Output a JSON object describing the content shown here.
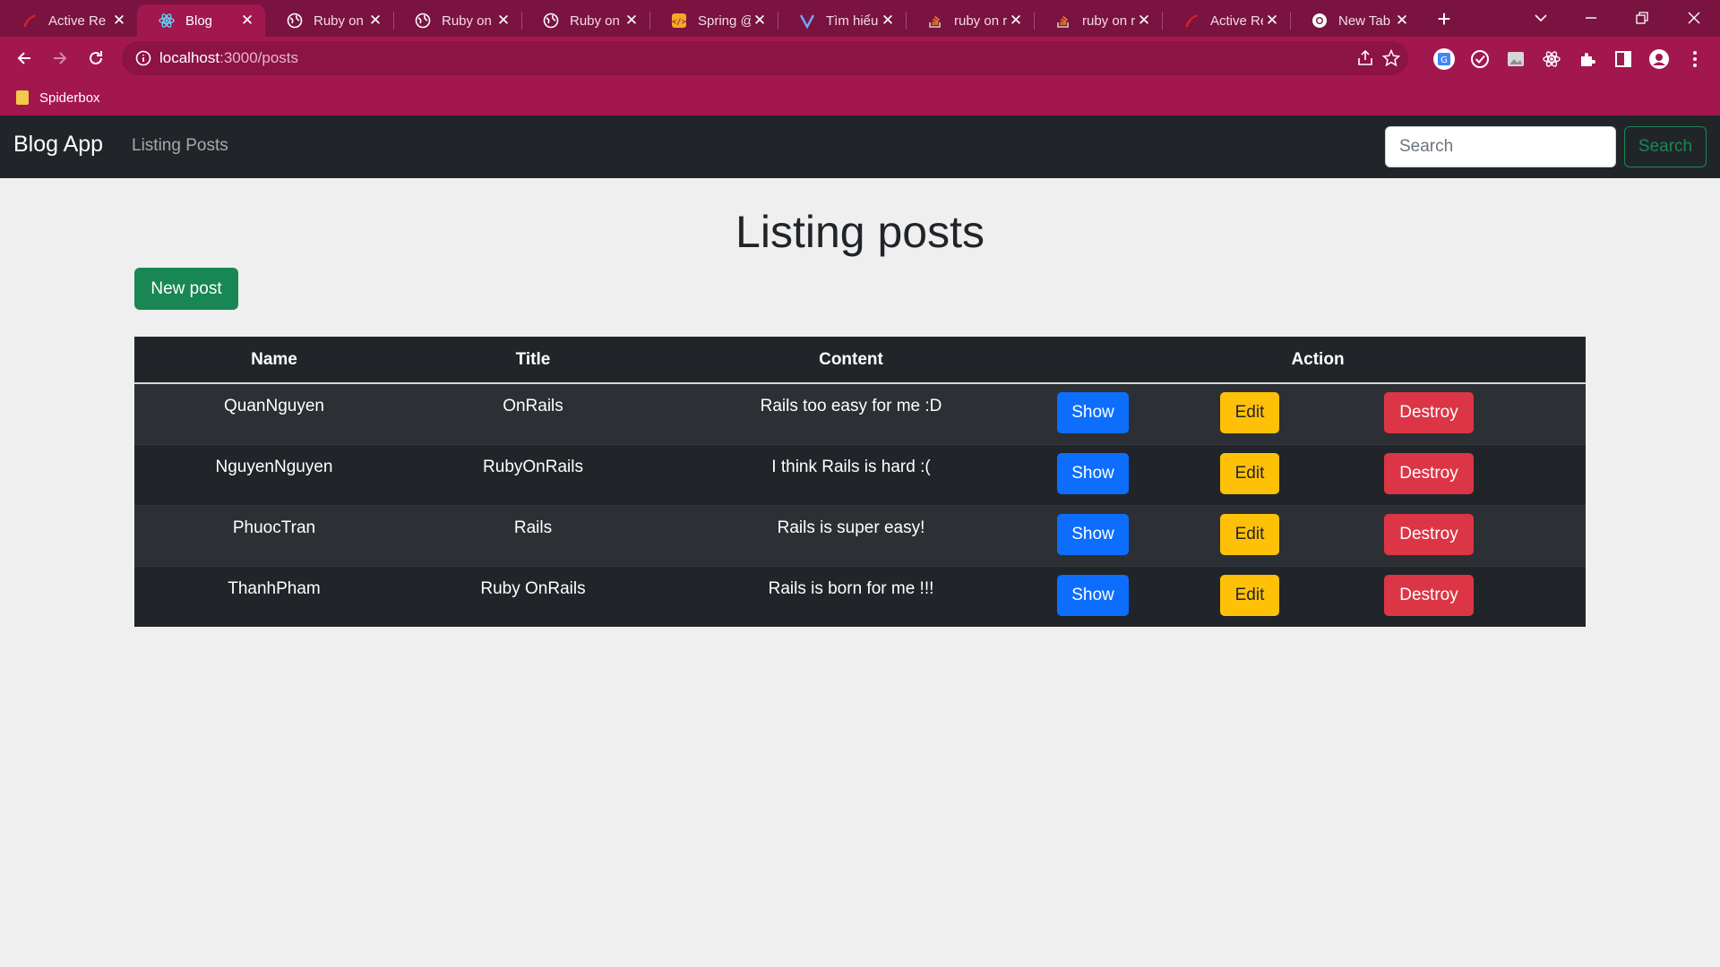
{
  "browser": {
    "tabs": [
      {
        "title": "Active Re",
        "icon": "rails-icon"
      },
      {
        "title": "Blog",
        "icon": "react-icon"
      },
      {
        "title": "Ruby on R",
        "icon": "globe-icon"
      },
      {
        "title": "Ruby on R",
        "icon": "globe-icon"
      },
      {
        "title": "Ruby on R",
        "icon": "globe-icon"
      },
      {
        "title": "Spring @",
        "icon": "code-icon"
      },
      {
        "title": "Tìm hiểu",
        "icon": "viblo-icon"
      },
      {
        "title": "ruby on r",
        "icon": "stackoverflow-icon"
      },
      {
        "title": "ruby on r",
        "icon": "stackoverflow-icon"
      },
      {
        "title": "Active Re",
        "icon": "rails-icon"
      },
      {
        "title": "New Tab",
        "icon": "chrome-icon"
      }
    ],
    "active_tab": 1,
    "url_host": "localhost",
    "url_path": ":3000/posts",
    "bookmark": "Spiderbox",
    "colors": {
      "frame": "#7a1340",
      "toolbar": "#a3174f"
    }
  },
  "navbar": {
    "brand": "Blog App",
    "link": "Listing Posts",
    "search_placeholder": "Search",
    "search_button": "Search"
  },
  "page": {
    "title": "Listing posts",
    "new_post": "New post"
  },
  "table": {
    "headers": {
      "name": "Name",
      "title": "Title",
      "content": "Content",
      "action": "Action"
    },
    "rows": [
      {
        "name": "QuanNguyen",
        "title": "OnRails",
        "content": "Rails too easy for me :D",
        "show": "Show",
        "edit": "Edit",
        "destroy": "Destroy"
      },
      {
        "name": "NguyenNguyen",
        "title": "RubyOnRails",
        "content": "I think Rails is hard :(",
        "show": "Show",
        "edit": "Edit",
        "destroy": "Destroy"
      },
      {
        "name": "PhuocTran",
        "title": "Rails",
        "content": "Rails is super easy!",
        "show": "Show",
        "edit": "Edit",
        "destroy": "Destroy"
      },
      {
        "name": "ThanhPham",
        "title": "Ruby OnRails",
        "content": "Rails is born for me !!!",
        "show": "Show",
        "edit": "Edit",
        "destroy": "Destroy"
      }
    ]
  }
}
